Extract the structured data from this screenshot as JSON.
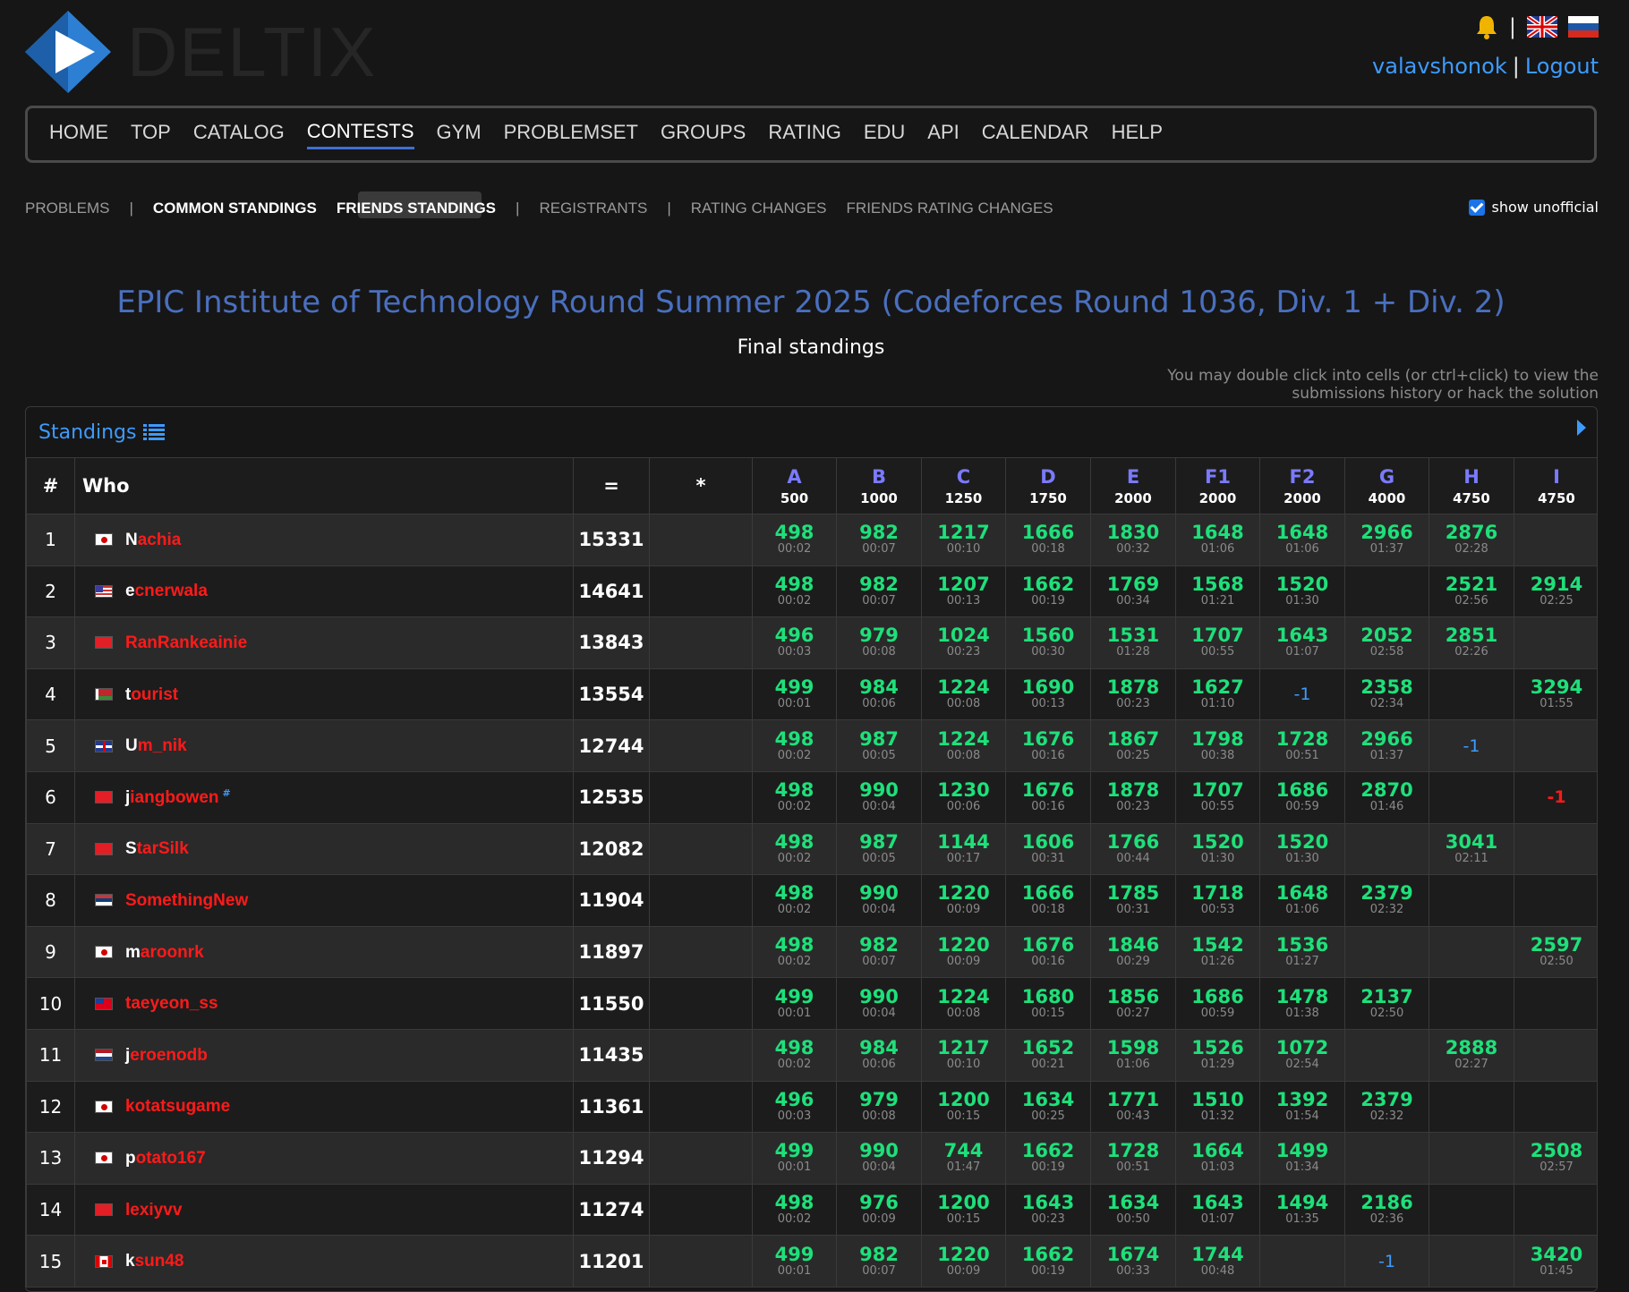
{
  "brand": {
    "name": "DELTIX"
  },
  "user": {
    "handle": "valavshonok",
    "logout": "Logout"
  },
  "nav": {
    "main": [
      "HOME",
      "TOP",
      "CATALOG",
      "CONTESTS",
      "GYM",
      "PROBLEMSET",
      "GROUPS",
      "RATING",
      "EDU",
      "API",
      "CALENDAR",
      "HELP"
    ],
    "main_active": "CONTESTS",
    "sub": {
      "problems": "PROBLEMS",
      "common_standings": "COMMON STANDINGS",
      "friends_standings": "FRIENDS STANDINGS",
      "registrants": "REGISTRANTS",
      "rating_changes": "RATING CHANGES",
      "friends_rating_changes": "FRIENDS RATING CHANGES"
    },
    "show_unofficial": "show unofficial"
  },
  "contest": {
    "title": "EPIC Institute of Technology Round Summer 2025 (Codeforces Round 1036, Div. 1 + Div. 2)",
    "subtitle": "Final standings",
    "hint": "You may double click into cells (or ctrl+click) to view the submissions history or hack the solution"
  },
  "standings": {
    "label": "Standings",
    "headers": {
      "rank": "#",
      "who": "Who",
      "eq": "=",
      "star": "*"
    },
    "problems": [
      {
        "label": "A",
        "points": "500"
      },
      {
        "label": "B",
        "points": "1000"
      },
      {
        "label": "C",
        "points": "1250"
      },
      {
        "label": "D",
        "points": "1750"
      },
      {
        "label": "E",
        "points": "2000"
      },
      {
        "label": "F1",
        "points": "2000"
      },
      {
        "label": "F2",
        "points": "2000"
      },
      {
        "label": "G",
        "points": "4000"
      },
      {
        "label": "H",
        "points": "4750"
      },
      {
        "label": "I",
        "points": "4750"
      }
    ],
    "rows": [
      {
        "rank": "1",
        "flag": "jp",
        "name": "Nachia",
        "score": "15331",
        "cells": [
          [
            "498",
            "00:02"
          ],
          [
            "982",
            "00:07"
          ],
          [
            "1217",
            "00:10"
          ],
          [
            "1666",
            "00:18"
          ],
          [
            "1830",
            "00:32"
          ],
          [
            "1648",
            "01:06"
          ],
          [
            "1648",
            "01:06"
          ],
          [
            "2966",
            "01:37"
          ],
          [
            "2876",
            "02:28"
          ],
          null
        ]
      },
      {
        "rank": "2",
        "flag": "us",
        "name": "ecnerwala",
        "score": "14641",
        "cells": [
          [
            "498",
            "00:02"
          ],
          [
            "982",
            "00:07"
          ],
          [
            "1207",
            "00:13"
          ],
          [
            "1662",
            "00:19"
          ],
          [
            "1769",
            "00:34"
          ],
          [
            "1568",
            "01:21"
          ],
          [
            "1520",
            "01:30"
          ],
          null,
          [
            "2521",
            "02:56"
          ],
          [
            "2914",
            "02:25"
          ]
        ]
      },
      {
        "rank": "3",
        "flag": "cn",
        "name": "RanRankeainie",
        "score": "13843",
        "cells": [
          [
            "496",
            "00:03"
          ],
          [
            "979",
            "00:08"
          ],
          [
            "1024",
            "00:23"
          ],
          [
            "1560",
            "00:30"
          ],
          [
            "1531",
            "01:28"
          ],
          [
            "1707",
            "00:55"
          ],
          [
            "1643",
            "01:07"
          ],
          [
            "2052",
            "02:58"
          ],
          [
            "2851",
            "02:26"
          ],
          null
        ]
      },
      {
        "rank": "4",
        "flag": "by",
        "name": "tourist",
        "score": "13554",
        "cells": [
          [
            "499",
            "00:01"
          ],
          [
            "984",
            "00:06"
          ],
          [
            "1224",
            "00:08"
          ],
          [
            "1690",
            "00:13"
          ],
          [
            "1878",
            "00:23"
          ],
          [
            "1627",
            "01:10"
          ],
          [
            "-1"
          ],
          [
            "2358",
            "02:34"
          ],
          null,
          [
            "3294",
            "01:55"
          ]
        ]
      },
      {
        "rank": "5",
        "flag": "gb",
        "name": "Um_nik",
        "score": "12744",
        "cells": [
          [
            "498",
            "00:02"
          ],
          [
            "987",
            "00:05"
          ],
          [
            "1224",
            "00:08"
          ],
          [
            "1676",
            "00:16"
          ],
          [
            "1867",
            "00:25"
          ],
          [
            "1798",
            "00:38"
          ],
          [
            "1728",
            "00:51"
          ],
          [
            "2966",
            "01:37"
          ],
          [
            "-1"
          ],
          null
        ]
      },
      {
        "rank": "6",
        "flag": "cn",
        "name": "jiangbowen",
        "sup": "#",
        "score": "12535",
        "cells": [
          [
            "498",
            "00:02"
          ],
          [
            "990",
            "00:04"
          ],
          [
            "1230",
            "00:06"
          ],
          [
            "1676",
            "00:16"
          ],
          [
            "1878",
            "00:23"
          ],
          [
            "1707",
            "00:55"
          ],
          [
            "1686",
            "00:59"
          ],
          [
            "2870",
            "01:46"
          ],
          null,
          [
            "-1r"
          ]
        ]
      },
      {
        "rank": "7",
        "flag": "cn",
        "name": "StarSilk",
        "score": "12082",
        "cells": [
          [
            "498",
            "00:02"
          ],
          [
            "987",
            "00:05"
          ],
          [
            "1144",
            "00:17"
          ],
          [
            "1606",
            "00:31"
          ],
          [
            "1766",
            "00:44"
          ],
          [
            "1520",
            "01:30"
          ],
          [
            "1520",
            "01:30"
          ],
          null,
          [
            "3041",
            "02:11"
          ],
          null
        ]
      },
      {
        "rank": "8",
        "flag": "rs",
        "name": "SomethingNew",
        "score": "11904",
        "cells": [
          [
            "498",
            "00:02"
          ],
          [
            "990",
            "00:04"
          ],
          [
            "1220",
            "00:09"
          ],
          [
            "1666",
            "00:18"
          ],
          [
            "1785",
            "00:31"
          ],
          [
            "1718",
            "00:53"
          ],
          [
            "1648",
            "01:06"
          ],
          [
            "2379",
            "02:32"
          ],
          null,
          null
        ]
      },
      {
        "rank": "9",
        "flag": "jp",
        "name": "maroonrk",
        "score": "11897",
        "cells": [
          [
            "498",
            "00:02"
          ],
          [
            "982",
            "00:07"
          ],
          [
            "1220",
            "00:09"
          ],
          [
            "1676",
            "00:16"
          ],
          [
            "1846",
            "00:29"
          ],
          [
            "1542",
            "01:26"
          ],
          [
            "1536",
            "01:27"
          ],
          null,
          null,
          [
            "2597",
            "02:50"
          ]
        ]
      },
      {
        "rank": "10",
        "flag": "tw",
        "name": "taeyeon_ss",
        "score": "11550",
        "cells": [
          [
            "499",
            "00:01"
          ],
          [
            "990",
            "00:04"
          ],
          [
            "1224",
            "00:08"
          ],
          [
            "1680",
            "00:15"
          ],
          [
            "1856",
            "00:27"
          ],
          [
            "1686",
            "00:59"
          ],
          [
            "1478",
            "01:38"
          ],
          [
            "2137",
            "02:50"
          ],
          null,
          null
        ]
      },
      {
        "rank": "11",
        "flag": "nl",
        "name": "jeroenodb",
        "score": "11435",
        "cells": [
          [
            "498",
            "00:02"
          ],
          [
            "984",
            "00:06"
          ],
          [
            "1217",
            "00:10"
          ],
          [
            "1652",
            "00:21"
          ],
          [
            "1598",
            "01:06"
          ],
          [
            "1526",
            "01:29"
          ],
          [
            "1072",
            "02:54"
          ],
          null,
          [
            "2888",
            "02:27"
          ],
          null
        ]
      },
      {
        "rank": "12",
        "flag": "jp",
        "name": "kotatsugame",
        "score": "11361",
        "cells": [
          [
            "496",
            "00:03"
          ],
          [
            "979",
            "00:08"
          ],
          [
            "1200",
            "00:15"
          ],
          [
            "1634",
            "00:25"
          ],
          [
            "1771",
            "00:43"
          ],
          [
            "1510",
            "01:32"
          ],
          [
            "1392",
            "01:54"
          ],
          [
            "2379",
            "02:32"
          ],
          null,
          null
        ]
      },
      {
        "rank": "13",
        "flag": "jp",
        "name": "potato167",
        "score": "11294",
        "cells": [
          [
            "499",
            "00:01"
          ],
          [
            "990",
            "00:04"
          ],
          [
            "744",
            "01:47"
          ],
          [
            "1662",
            "00:19"
          ],
          [
            "1728",
            "00:51"
          ],
          [
            "1664",
            "01:03"
          ],
          [
            "1499",
            "01:34"
          ],
          null,
          null,
          [
            "2508",
            "02:57"
          ]
        ]
      },
      {
        "rank": "14",
        "flag": "cn",
        "name": "lexiyvv",
        "score": "11274",
        "cells": [
          [
            "498",
            "00:02"
          ],
          [
            "976",
            "00:09"
          ],
          [
            "1200",
            "00:15"
          ],
          [
            "1643",
            "00:23"
          ],
          [
            "1634",
            "00:50"
          ],
          [
            "1643",
            "01:07"
          ],
          [
            "1494",
            "01:35"
          ],
          [
            "2186",
            "02:36"
          ],
          null,
          null
        ]
      },
      {
        "rank": "15",
        "flag": "ca",
        "name": "ksun48",
        "score": "11201",
        "cells": [
          [
            "499",
            "00:01"
          ],
          [
            "982",
            "00:07"
          ],
          [
            "1220",
            "00:09"
          ],
          [
            "1662",
            "00:19"
          ],
          [
            "1674",
            "00:33"
          ],
          [
            "1744",
            "00:48"
          ],
          null,
          [
            "-1"
          ],
          null,
          [
            "3420",
            "01:45"
          ]
        ]
      }
    ],
    "first_letter_white": [
      "Nachia",
      "ecnerwala",
      "tourist",
      "Um_nik",
      "jiangbowen",
      "StarSilk",
      "maroonrk",
      "jeroenodb",
      "potato167",
      "ksun48"
    ]
  }
}
